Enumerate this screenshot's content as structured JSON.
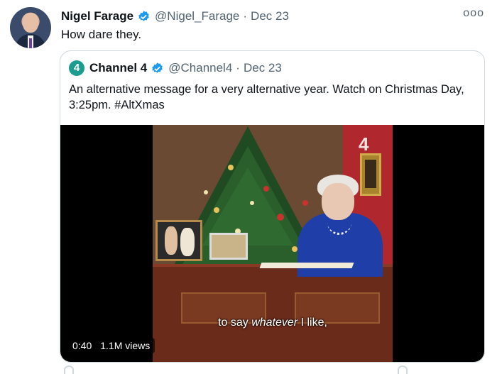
{
  "tweet": {
    "author_name": "Nigel Farage",
    "author_handle": "@Nigel_Farage",
    "separator": "·",
    "date": "Dec 23",
    "more_label": "ooo",
    "text": "How dare they."
  },
  "quote": {
    "author_name": "Channel 4",
    "logo_text": "4",
    "author_handle": "@Channel4",
    "separator": "·",
    "date": "Dec 23",
    "text": "An alternative message for a very alternative year. Watch on Christmas Day, 3:25pm. #AltXmas",
    "video": {
      "caption_prefix": "to say ",
      "caption_emphasis": "whatever",
      "caption_suffix": " I like,",
      "watermark": "4",
      "time": "0:40",
      "views": "1.1M views"
    }
  },
  "colors": {
    "verified": "#1d9bf0",
    "channel4_logo": "#1b9e8f",
    "secondary_text": "#536471"
  },
  "icons": [
    "verified-badge-icon",
    "more-options-icon",
    "channel4-logo-icon"
  ]
}
